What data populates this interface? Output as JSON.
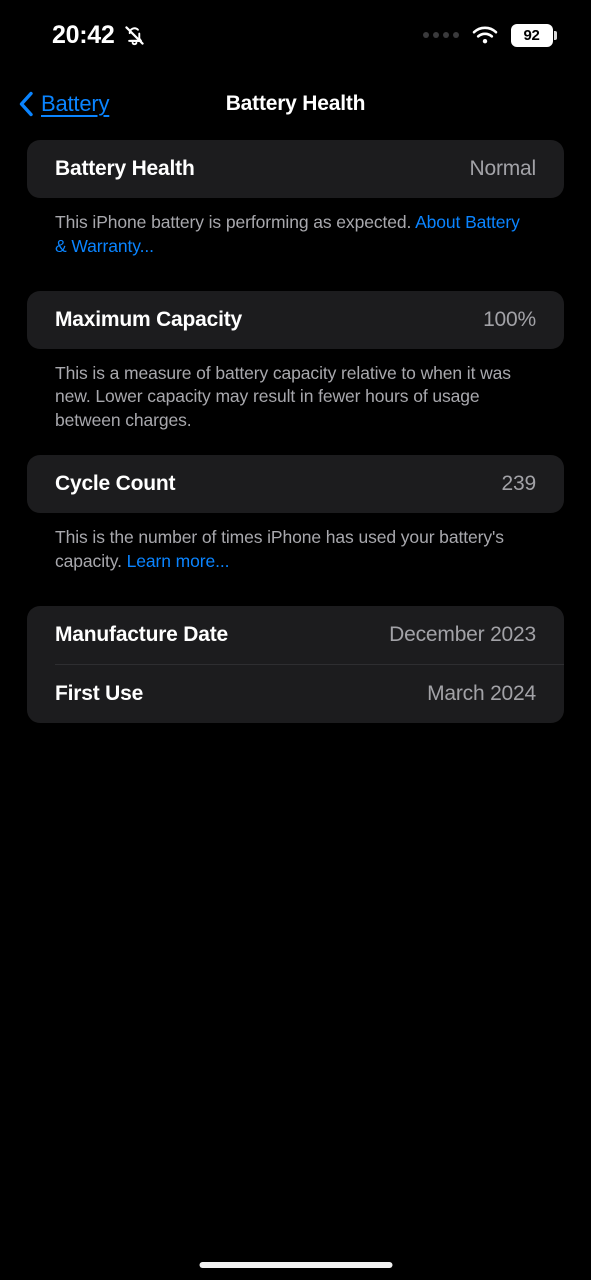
{
  "status_bar": {
    "time": "20:42",
    "silent_icon": "bell-slash-icon",
    "signal_icon": "signal-dots-icon",
    "wifi_icon": "wifi-icon",
    "battery_percent": "92"
  },
  "nav": {
    "back_icon": "chevron-left-icon",
    "back_label": "Battery",
    "title": "Battery Health"
  },
  "sections": [
    {
      "row_label": "Battery Health",
      "row_value": "Normal",
      "footer_text": "This iPhone battery is performing as expected. ",
      "footer_link": "About Battery & Warranty..."
    },
    {
      "row_label": "Maximum Capacity",
      "row_value": "100%",
      "footer_text": "This is a measure of battery capacity relative to when it was new. Lower capacity may result in fewer hours of usage between charges.",
      "footer_link": ""
    },
    {
      "row_label": "Cycle Count",
      "row_value": "239",
      "footer_text": "This is the number of times iPhone has used your battery's capacity. ",
      "footer_link": "Learn more..."
    }
  ],
  "info_rows": [
    {
      "label": "Manufacture Date",
      "value": "December 2023"
    },
    {
      "label": "First Use",
      "value": "March 2024"
    }
  ],
  "colors": {
    "background": "#000000",
    "card": "#1c1c1e",
    "accent_link": "#0a84ff",
    "secondary_text": "#a2a2a7"
  }
}
